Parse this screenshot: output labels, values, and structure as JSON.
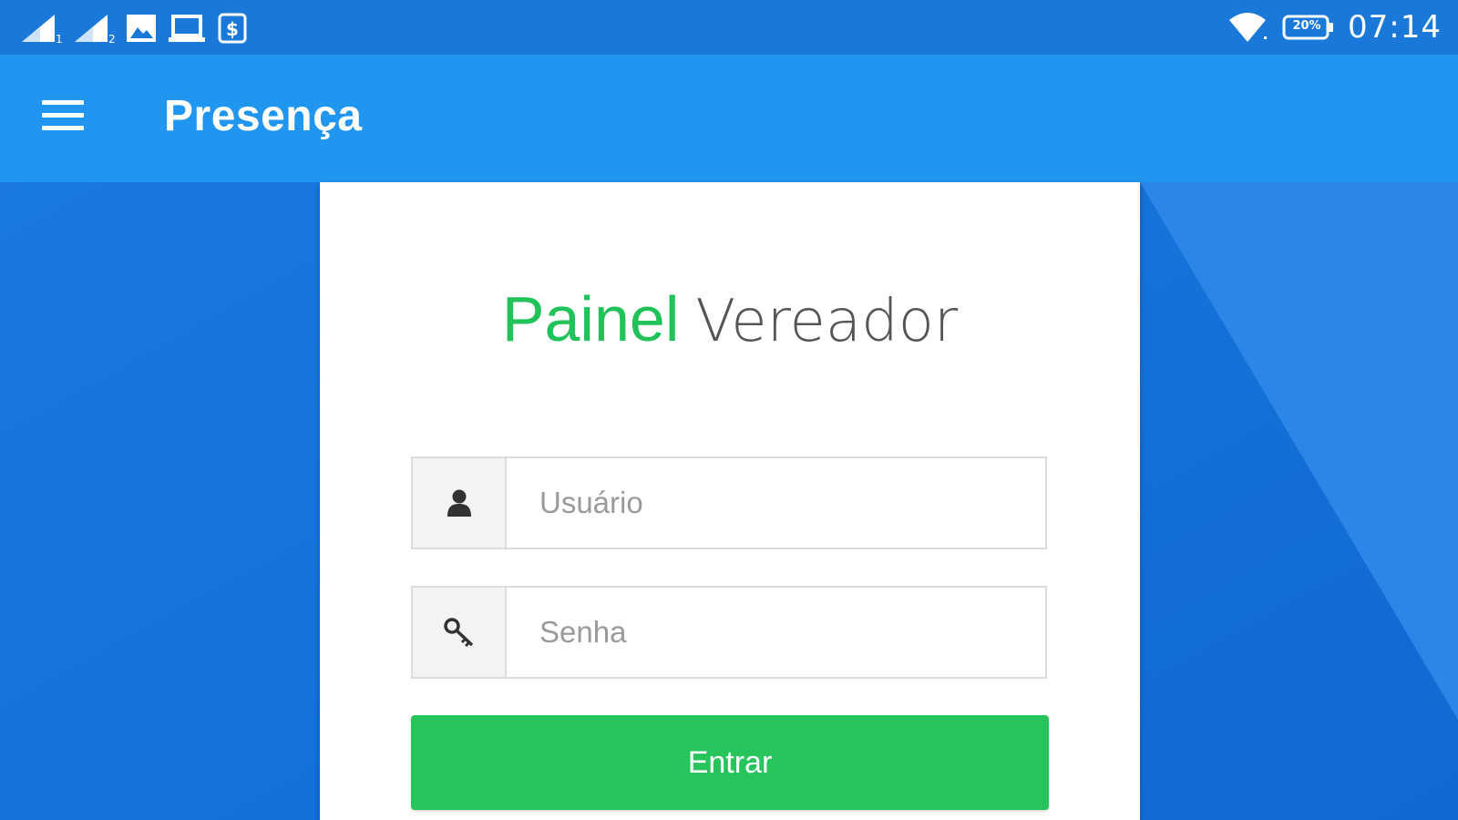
{
  "statusbar": {
    "time": "07:14",
    "battery": "20%",
    "left_icons": [
      "signal-sim1-icon",
      "signal-sim2-icon",
      "image-notification-icon",
      "laptop-notification-icon",
      "money-notification-icon"
    ],
    "right_icons": [
      "wifi-icon",
      "battery-icon"
    ]
  },
  "appbar": {
    "menu_icon": "hamburger-menu-icon",
    "title": "Presença"
  },
  "login": {
    "brand_primary": "Painel",
    "brand_secondary": "Vereador",
    "username": {
      "placeholder": "Usuário",
      "value": "",
      "icon": "user-icon"
    },
    "password": {
      "placeholder": "Senha",
      "value": "",
      "icon": "key-icon"
    },
    "submit_label": "Entrar"
  },
  "colors": {
    "statusbar": "#1a79d8",
    "appbar": "#2196f0",
    "background": "#1877dd",
    "accent_green": "#27c45c"
  }
}
